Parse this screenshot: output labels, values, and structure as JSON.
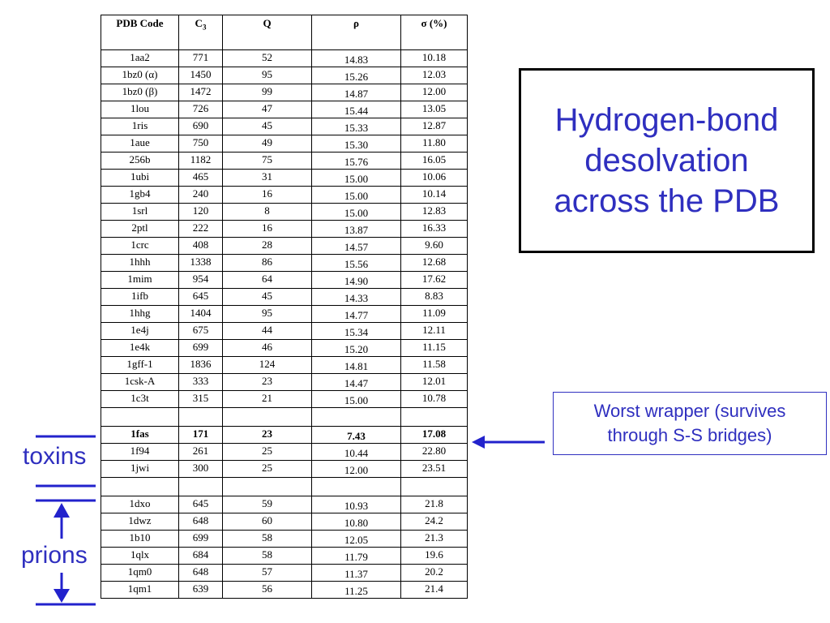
{
  "table": {
    "headers": {
      "pdb": "PDB Code",
      "c3": "C",
      "c3_sub": "3",
      "q": "Q",
      "rho": "ρ",
      "sigma": "σ (%)"
    },
    "rows": [
      {
        "pdb": "1aa2",
        "c3": "771",
        "q": "52",
        "rho": "14.83",
        "sigma": "10.18"
      },
      {
        "pdb": "1bz0 (α)",
        "c3": "1450",
        "q": "95",
        "rho": "15.26",
        "sigma": "12.03"
      },
      {
        "pdb": "1bz0 (β)",
        "c3": "1472",
        "q": "99",
        "rho": "14.87",
        "sigma": "12.00"
      },
      {
        "pdb": "1lou",
        "c3": "726",
        "q": "47",
        "rho": "15.44",
        "sigma": "13.05"
      },
      {
        "pdb": "1ris",
        "c3": "690",
        "q": "45",
        "rho": "15.33",
        "sigma": "12.87"
      },
      {
        "pdb": "1aue",
        "c3": "750",
        "q": "49",
        "rho": "15.30",
        "sigma": "11.80"
      },
      {
        "pdb": "256b",
        "c3": "1182",
        "q": "75",
        "rho": "15.76",
        "sigma": "16.05"
      },
      {
        "pdb": "1ubi",
        "c3": "465",
        "q": "31",
        "rho": "15.00",
        "sigma": "10.06"
      },
      {
        "pdb": "1gb4",
        "c3": "240",
        "q": "16",
        "rho": "15.00",
        "sigma": "10.14"
      },
      {
        "pdb": "1srl",
        "c3": "120",
        "q": "8",
        "rho": "15.00",
        "sigma": "12.83"
      },
      {
        "pdb": "2ptl",
        "c3": "222",
        "q": "16",
        "rho": "13.87",
        "sigma": "16.33"
      },
      {
        "pdb": "1crc",
        "c3": "408",
        "q": "28",
        "rho": "14.57",
        "sigma": "9.60"
      },
      {
        "pdb": "1hhh",
        "c3": "1338",
        "q": "86",
        "rho": "15.56",
        "sigma": "12.68"
      },
      {
        "pdb": "1mim",
        "c3": "954",
        "q": "64",
        "rho": "14.90",
        "sigma": "17.62"
      },
      {
        "pdb": "1ifb",
        "c3": "645",
        "q": "45",
        "rho": "14.33",
        "sigma": "8.83"
      },
      {
        "pdb": "1hhg",
        "c3": "1404",
        "q": "95",
        "rho": "14.77",
        "sigma": "11.09"
      },
      {
        "pdb": "1e4j",
        "c3": "675",
        "q": "44",
        "rho": "15.34",
        "sigma": "12.11"
      },
      {
        "pdb": "1e4k",
        "c3": "699",
        "q": "46",
        "rho": "15.20",
        "sigma": "11.15"
      },
      {
        "pdb": "1gff-1",
        "c3": "1836",
        "q": "124",
        "rho": "14.81",
        "sigma": "11.58"
      },
      {
        "pdb": "1csk-A",
        "c3": "333",
        "q": "23",
        "rho": "14.47",
        "sigma": "12.01"
      },
      {
        "pdb": "1c3t",
        "c3": "315",
        "q": "21",
        "rho": "15.00",
        "sigma": "10.78"
      },
      {
        "blank": true
      },
      {
        "pdb": "1fas",
        "c3": "171",
        "q": "23",
        "rho": "7.43",
        "sigma": "17.08",
        "bold": true
      },
      {
        "pdb": "1f94",
        "c3": "261",
        "q": "25",
        "rho": "10.44",
        "sigma": "22.80"
      },
      {
        "pdb": "1jwi",
        "c3": "300",
        "q": "25",
        "rho": "12.00",
        "sigma": "23.51"
      },
      {
        "blank": true
      },
      {
        "pdb": "1dxo",
        "c3": "645",
        "q": "59",
        "rho": "10.93",
        "sigma": "21.8"
      },
      {
        "pdb": "1dwz",
        "c3": "648",
        "q": "60",
        "rho": "10.80",
        "sigma": "24.2"
      },
      {
        "pdb": "1b10",
        "c3": "699",
        "q": "58",
        "rho": "12.05",
        "sigma": "21.3"
      },
      {
        "pdb": "1qlx",
        "c3": "684",
        "q": "58",
        "rho": "11.79",
        "sigma": "19.6"
      },
      {
        "pdb": "1qm0",
        "c3": "648",
        "q": "57",
        "rho": "11.37",
        "sigma": "20.2"
      },
      {
        "pdb": "1qm1",
        "c3": "639",
        "q": "56",
        "rho": "11.25",
        "sigma": "21.4"
      }
    ]
  },
  "title_box": {
    "text": "Hydrogen-bond\ndesolvation\nacross the PDB"
  },
  "annotation": {
    "text": "Worst wrapper (survives\nthrough S-S bridges)"
  },
  "labels": {
    "toxins": "toxins",
    "prions": "prions"
  },
  "colors": {
    "accent": "#2f2fbf",
    "line": "#3030c0"
  }
}
